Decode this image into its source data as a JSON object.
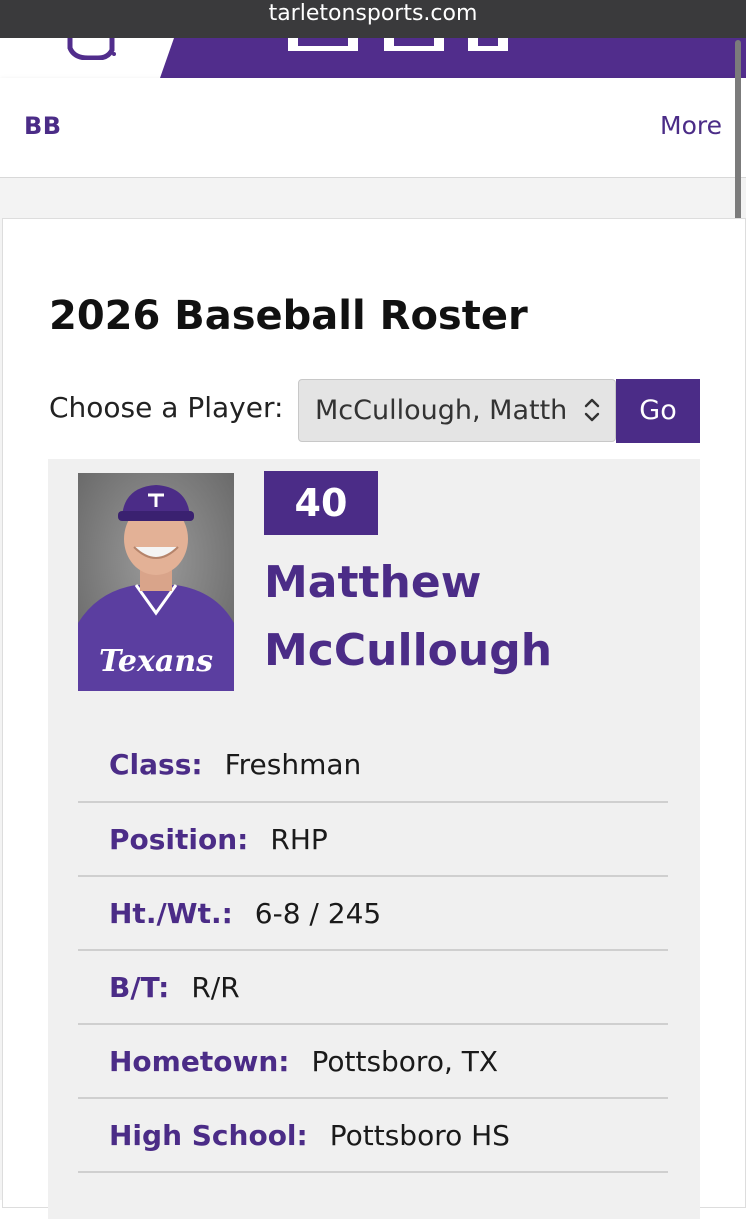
{
  "browser": {
    "url": "tarletonsports.com"
  },
  "nav": {
    "sport_label": "BB",
    "more_label": "More"
  },
  "page": {
    "title": "2026 Baseball Roster"
  },
  "player_select": {
    "label": "Choose a Player:",
    "selected": "McCullough, Matthew",
    "go_label": "Go"
  },
  "player": {
    "number": "40",
    "first_name": "Matthew",
    "last_name": "McCullough",
    "jersey_text": "Texans",
    "bio": [
      {
        "label": "Class:",
        "value": "Freshman"
      },
      {
        "label": "Position:",
        "value": "RHP"
      },
      {
        "label": "Ht./Wt.:",
        "value": "6-8 / 245"
      },
      {
        "label": "B/T:",
        "value": "R/R"
      },
      {
        "label": "Hometown:",
        "value": "Pottsboro, TX"
      },
      {
        "label": "High School:",
        "value": "Pottsboro HS"
      }
    ]
  },
  "colors": {
    "brand_purple": "#4b2c87",
    "panel_gray": "#f0f0f0",
    "url_bar": "#3a3a3c"
  }
}
